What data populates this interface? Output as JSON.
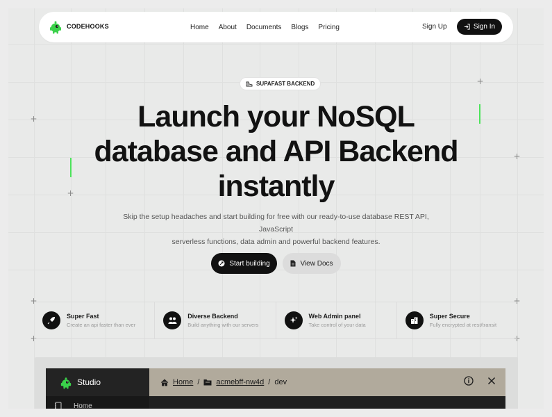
{
  "navbar": {
    "brand": "CODEHOOKS",
    "links": [
      "Home",
      "About",
      "Documents",
      "Blogs",
      "Pricing"
    ],
    "signup": "Sign Up",
    "signin": "Sign In"
  },
  "hero": {
    "badge": "SUPAFAST BACKEND",
    "title_line1": "Launch your NoSQL",
    "title_line2": "database and API Backend",
    "title_line3": "instantly",
    "subtitle_line1": "Skip the setup headaches and start building for free with our ready-to-use database REST API, JavaScript",
    "subtitle_line2": "serverless functions, data admin and powerful backend features.",
    "btn_start": "Start building",
    "btn_docs": "View Docs"
  },
  "features": [
    {
      "title": "Super Fast",
      "desc": "Create an api faster than ever",
      "icon": "rocket-icon"
    },
    {
      "title": "Diverse Backend",
      "desc": "Build anything with our servers",
      "icon": "users-icon"
    },
    {
      "title": "Web Admin panel",
      "desc": "Take control of your data",
      "icon": "sparkle-icon"
    },
    {
      "title": "Super Secure",
      "desc": "Fully encrypted at rest/transit",
      "icon": "building-icon"
    }
  ],
  "studio": {
    "name": "Studio",
    "crumb_home": "Home",
    "crumb_project": "acmebff-nw4d",
    "crumb_space": "dev",
    "side_home": "Home"
  },
  "colors": {
    "accent_green": "#4ce35a",
    "dark": "#111111",
    "studio_bar": "#b1aa9c"
  }
}
